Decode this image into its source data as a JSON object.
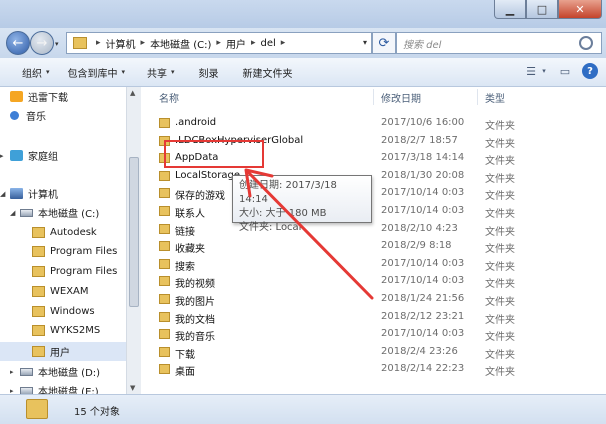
{
  "window": {
    "minimize_glyph": "▁",
    "maximize_glyph": "□",
    "close_glyph": "✕"
  },
  "nav_buttons": {
    "back_glyph": "←",
    "forward_glyph": "→",
    "recent_glyph": "▾"
  },
  "address": {
    "crumbs": [
      "计算机",
      "本地磁盘 (C:)",
      "用户",
      "del"
    ],
    "separator": "▸",
    "dropdown_glyph": "▾"
  },
  "refresh_glyph": "⟳",
  "search": {
    "placeholder": "搜索 del"
  },
  "toolbar": {
    "organize": "组织",
    "include_in_library": "包含到库中",
    "share": "共享",
    "burn": "刻录",
    "new_folder": "新建文件夹",
    "dropdown_glyph": "▾",
    "view_glyph": "☰",
    "preview_glyph": "▭",
    "help_glyph": "?"
  },
  "nav_pane": {
    "items": [
      {
        "label": "迅雷下载",
        "icon": "download-icon"
      },
      {
        "label": "音乐",
        "icon": "music-icon"
      },
      {
        "label": "家庭组",
        "icon": "homegroup-icon"
      },
      {
        "label": "计算机",
        "icon": "computer-icon"
      },
      {
        "label": "本地磁盘 (C:)",
        "icon": "drive-icon"
      },
      {
        "label": "Autodesk",
        "icon": "folder-icon"
      },
      {
        "label": "Program Files",
        "icon": "folder-icon"
      },
      {
        "label": "Program Files",
        "icon": "folder-icon"
      },
      {
        "label": "WEXAM",
        "icon": "folder-icon"
      },
      {
        "label": "Windows",
        "icon": "folder-icon"
      },
      {
        "label": "WYKS2MS",
        "icon": "folder-icon"
      },
      {
        "label": "用户",
        "icon": "folder-icon"
      },
      {
        "label": "本地磁盘 (D:)",
        "icon": "drive-icon"
      },
      {
        "label": "本地磁盘 (E:)",
        "icon": "drive-icon"
      }
    ],
    "expand_glyph": "▸",
    "collapse_glyph": "◢"
  },
  "columns": {
    "name": "名称",
    "date": "修改日期",
    "type": "类型"
  },
  "files": [
    {
      "name": ".android",
      "date": "2017/10/6 16:00",
      "type": "文件夹"
    },
    {
      "name": ".LDCBoxHyperviserGlobal",
      "date": "2018/2/7 18:57",
      "type": "文件夹"
    },
    {
      "name": "AppData",
      "date": "2017/3/18 14:14",
      "type": "文件夹"
    },
    {
      "name": "LocalStorage",
      "date": "2018/1/30 20:08",
      "type": "文件夹"
    },
    {
      "name": "保存的游戏",
      "date": "2017/10/14 0:03",
      "type": "文件夹"
    },
    {
      "name": "联系人",
      "date": "2017/10/14 0:03",
      "type": "文件夹"
    },
    {
      "name": "链接",
      "date": "2018/2/10 4:23",
      "type": "文件夹"
    },
    {
      "name": "收藏夹",
      "date": "2018/2/9 8:18",
      "type": "文件夹"
    },
    {
      "name": "搜索",
      "date": "2017/10/14 0:03",
      "type": "文件夹"
    },
    {
      "name": "我的视频",
      "date": "2017/10/14 0:03",
      "type": "文件夹"
    },
    {
      "name": "我的图片",
      "date": "2018/1/24 21:56",
      "type": "文件夹"
    },
    {
      "name": "我的文档",
      "date": "2018/2/12 23:21",
      "type": "文件夹"
    },
    {
      "name": "我的音乐",
      "date": "2017/10/14 0:03",
      "type": "文件夹"
    },
    {
      "name": "下载",
      "date": "2018/2/4 23:26",
      "type": "文件夹"
    },
    {
      "name": "桌面",
      "date": "2018/2/14 22:23",
      "type": "文件夹"
    }
  ],
  "tooltip": {
    "line1": "创建日期: 2017/3/18 14:14",
    "line2": "大小: 大于 180 MB",
    "line3": "文件夹: Local"
  },
  "status": {
    "count": "15 个对象"
  },
  "colors": {
    "annotation": "#e53935",
    "folder": "#e8c25d"
  }
}
